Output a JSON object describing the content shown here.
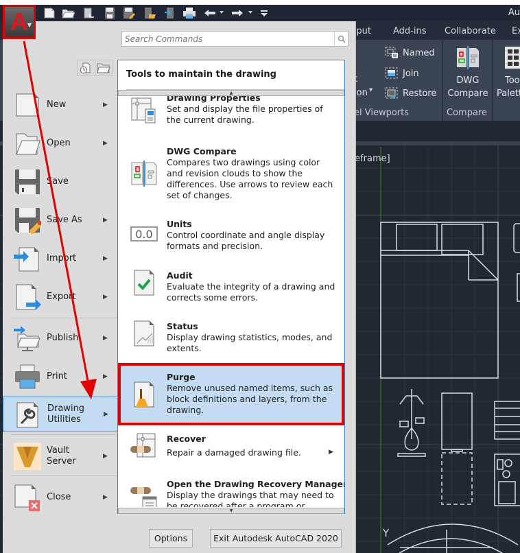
{
  "window": {
    "title": "Au"
  },
  "quick_access": {
    "icons": [
      "new-icon",
      "open-icon",
      "open-from-web-icon",
      "save-icon",
      "save-as-icon",
      "open-from-mobile-icon",
      "save-to-mobile-icon",
      "plot-icon",
      "undo-icon",
      "undo-dropdown-icon",
      "redo-icon",
      "redo-dropdown-icon",
      "customize-qat-icon"
    ]
  },
  "ribbon": {
    "tabs": [
      "utput",
      "Add-ins",
      "Collaborate",
      "Ex"
    ],
    "viewports_panel": {
      "partial_label_top": "t",
      "partial_label_bottom": "ion",
      "buttons": [
        "Named",
        "Join",
        "Restore"
      ],
      "label": "el Viewports"
    },
    "compare_panel": {
      "button_line1": "DWG",
      "button_line2": "Compare",
      "label": "Compare"
    },
    "tool_palettes": {
      "line1": "Too",
      "line2": "Palett"
    }
  },
  "canvas": {
    "viewport_label": "reframe]",
    "ucs_axis_label": "Y"
  },
  "app_menu": {
    "search": {
      "placeholder": "Search Commands",
      "value": ""
    },
    "recent_buttons": [
      "recent-documents-icon",
      "open-documents-icon"
    ],
    "items": [
      {
        "label": "New",
        "icon": "new-file-icon",
        "has_submenu": true
      },
      {
        "label": "Open",
        "icon": "open-folder-icon",
        "has_submenu": true
      },
      {
        "label": "Save",
        "icon": "save-disk-icon",
        "has_submenu": false
      },
      {
        "label": "Save As",
        "icon": "save-as-icon",
        "has_submenu": true
      },
      {
        "label": "Import",
        "icon": "import-icon",
        "has_submenu": true
      },
      {
        "label": "Export",
        "icon": "export-icon",
        "has_submenu": true
      },
      {
        "label": "Publish",
        "icon": "publish-icon",
        "has_submenu": true
      },
      {
        "label": "Print",
        "icon": "print-icon",
        "has_submenu": true
      },
      {
        "label_line1": "Drawing",
        "label_line2": "Utilities",
        "icon": "drawing-utilities-icon",
        "has_submenu": true,
        "active": true
      },
      {
        "label_line1": "Vault",
        "label_line2": "Server",
        "icon": "vault-icon",
        "has_submenu": true
      },
      {
        "label": "Close",
        "icon": "close-file-icon",
        "has_submenu": true
      }
    ],
    "submenu": {
      "title": "Tools to maintain the drawing",
      "items": [
        {
          "title": "Drawing Properties",
          "description": "Set and display the file properties of the current drawing.",
          "icon": "drawing-properties-icon"
        },
        {
          "title": "DWG Compare",
          "description": "Compares two drawings using color and revision clouds to show the differences. Use arrows to review each set of changes.",
          "icon": "dwg-compare-icon"
        },
        {
          "title": "Units",
          "description": "Control coordinate and angle display formats and precision.",
          "icon": "units-icon",
          "icon_text": "0.0"
        },
        {
          "title": "Audit",
          "description": "Evaluate the integrity of a drawing and corrects some errors.",
          "icon": "audit-icon"
        },
        {
          "title": "Status",
          "description": "Display drawing statistics, modes, and extents.",
          "icon": "status-icon"
        },
        {
          "title": "Purge",
          "description": "Remove unused named items, such as block definitions and layers, from the drawing.",
          "icon": "purge-icon",
          "highlighted": true
        },
        {
          "title": "Recover",
          "description": "Repair a damaged drawing file.",
          "icon": "recover-icon",
          "has_submenu": true
        },
        {
          "title": "Open the Drawing Recovery Manager",
          "description": "Display the drawings that may need to be recovered after a program or system failure.",
          "icon": "recovery-manager-icon"
        }
      ]
    },
    "footer": {
      "options_label": "Options",
      "exit_label": "Exit Autodesk AutoCAD 2020"
    }
  },
  "colors": {
    "annotation_red": "#e30000",
    "highlight_blue": "#c4dcf2",
    "border_blue": "#3c85cc",
    "canvas_bg": "#212830",
    "ribbon_bg": "#3b4453"
  }
}
